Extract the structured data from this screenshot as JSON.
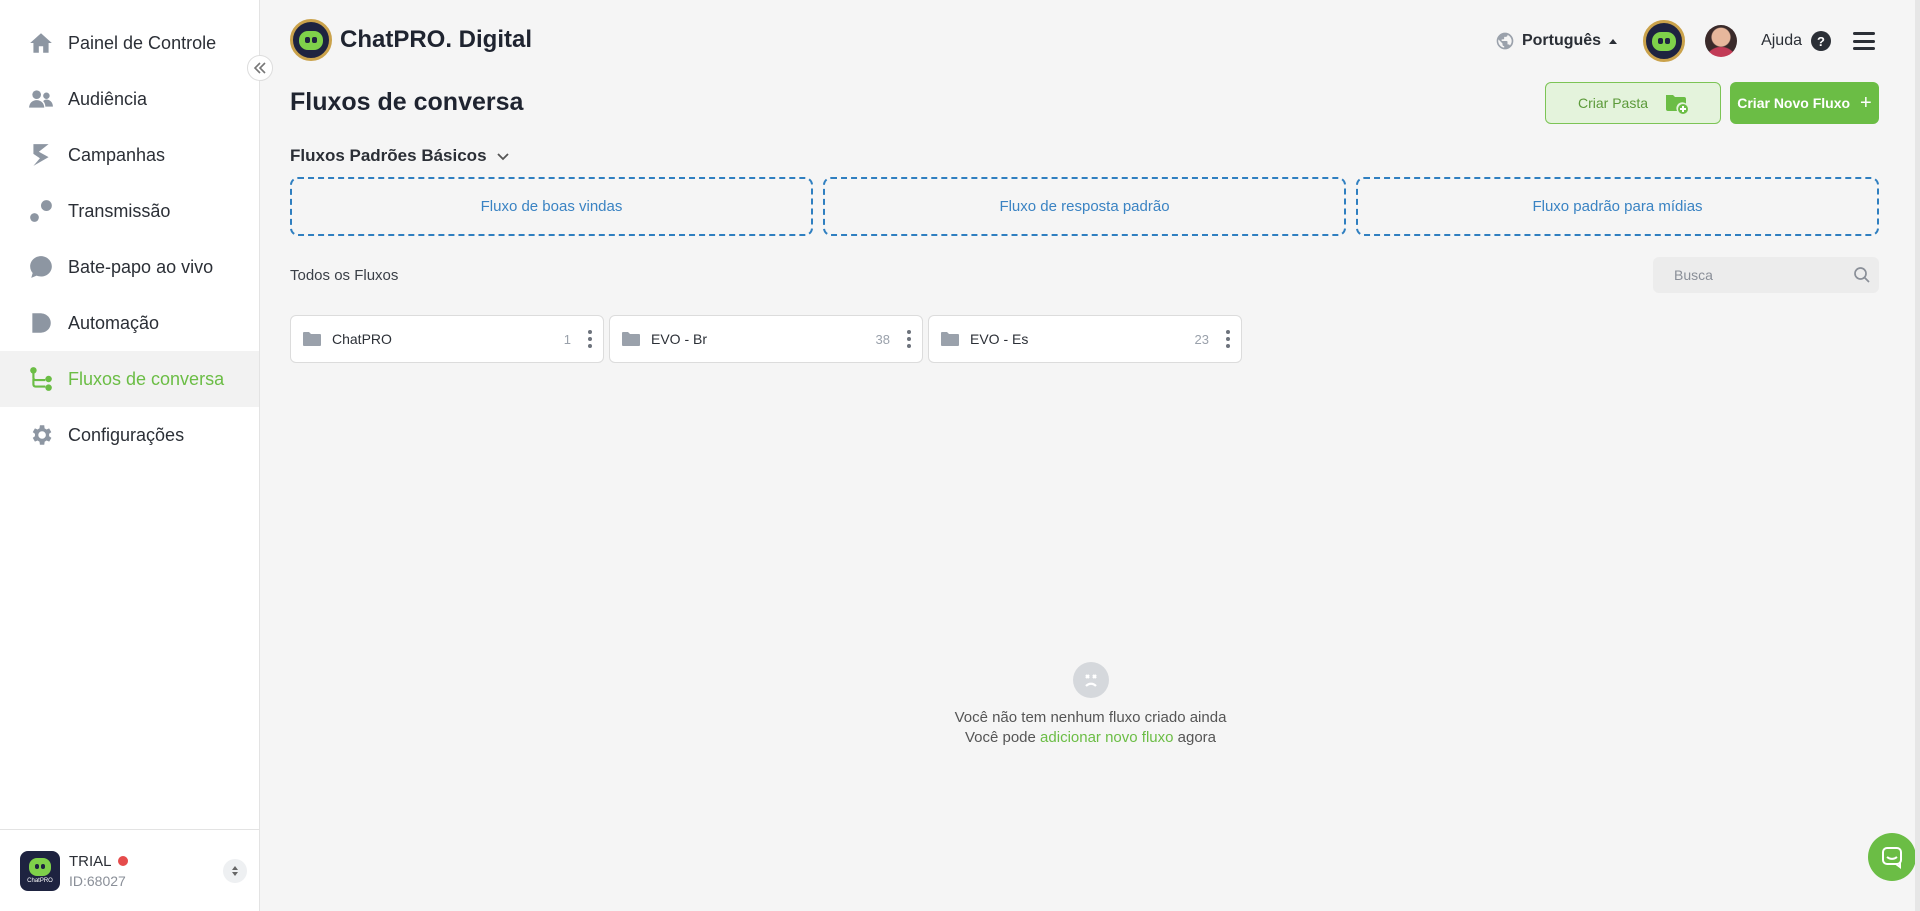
{
  "sidebar": {
    "items": [
      {
        "label": "Painel de Controle",
        "icon": "home-icon"
      },
      {
        "label": "Audiência",
        "icon": "users-icon"
      },
      {
        "label": "Campanhas",
        "icon": "campaign-icon"
      },
      {
        "label": "Transmissão",
        "icon": "broadcast-icon"
      },
      {
        "label": "Bate-papo ao vivo",
        "icon": "chat-bubble-icon"
      },
      {
        "label": "Automação",
        "icon": "automation-icon"
      },
      {
        "label": "Fluxos de conversa",
        "icon": "flow-icon",
        "active": true
      },
      {
        "label": "Configurações",
        "icon": "gear-icon"
      }
    ],
    "account": {
      "plan": "TRIAL",
      "id": "ID:68027",
      "logo_text": "ChatPRO"
    }
  },
  "header": {
    "brand": "ChatPRO. Digital",
    "language": "Português",
    "help": "Ajuda"
  },
  "page": {
    "title": "Fluxos de conversa",
    "create_folder": "Criar Pasta",
    "create_flow": "Criar Novo Fluxo",
    "basic_section": "Fluxos Padrões Básicos",
    "basic_flows": [
      "Fluxo de boas vindas",
      "Fluxo de resposta padrão",
      "Fluxo padrão para mídias"
    ],
    "all_flows_label": "Todos os Fluxos",
    "search_placeholder": "Busca",
    "folders": [
      {
        "name": "ChatPRO",
        "count": "1"
      },
      {
        "name": "EVO - Br",
        "count": "38"
      },
      {
        "name": "EVO - Es",
        "count": "23"
      }
    ],
    "empty": {
      "line1": "Você não tem nenhum fluxo criado ainda",
      "line2_prefix": "Você pode",
      "line2_link": "adicionar novo fluxo",
      "line2_suffix": "agora"
    }
  },
  "colors": {
    "accent": "#6bbd45",
    "link_blue": "#3a83c3",
    "status_red": "#e54b4b"
  }
}
